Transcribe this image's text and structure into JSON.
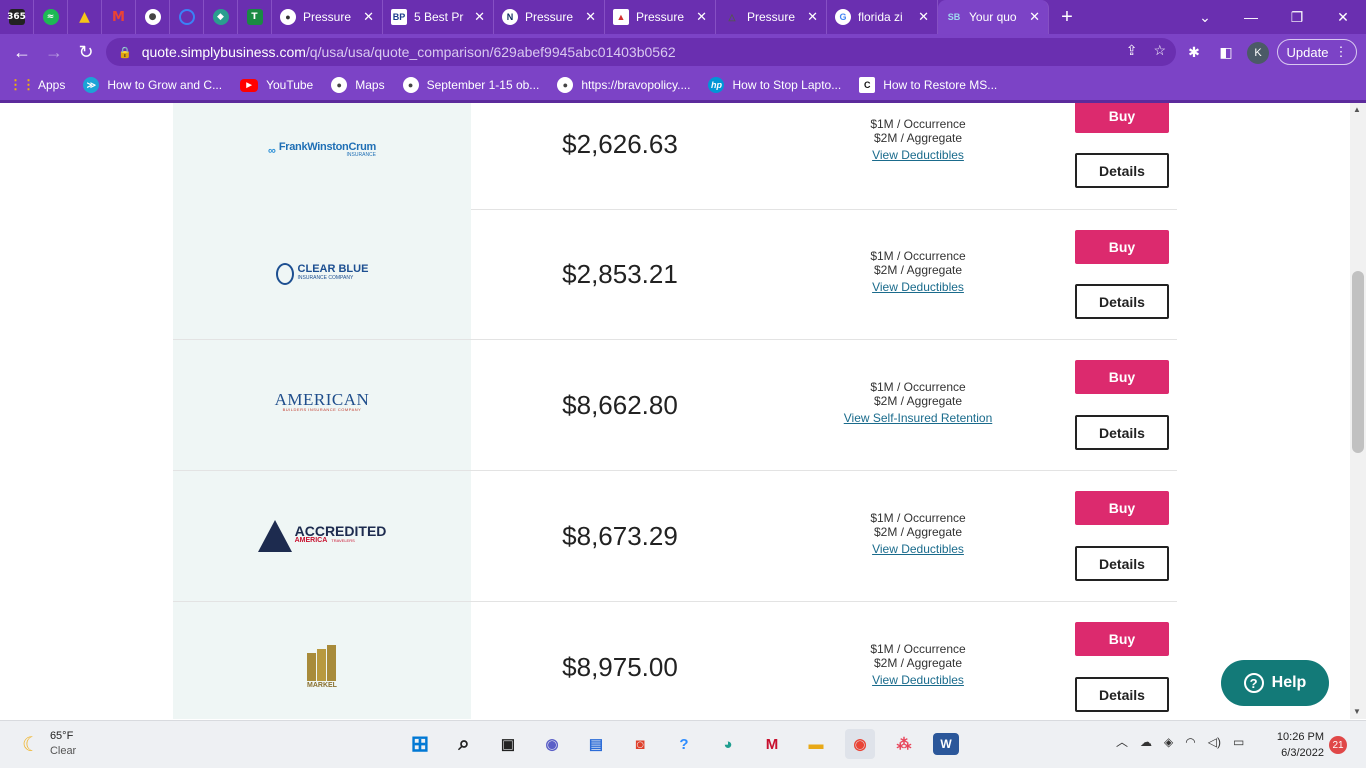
{
  "browser": {
    "tabs": [
      {
        "title": "Pressure",
        "icon": "globe-icon"
      },
      {
        "title": "5 Best Pr",
        "icon": "bp-icon"
      },
      {
        "title": "Pressure",
        "icon": "n-icon"
      },
      {
        "title": "Pressure",
        "icon": "red-logo-icon"
      },
      {
        "title": "Pressure",
        "icon": "triangle-icon"
      },
      {
        "title": "florida zi",
        "icon": "google-icon"
      },
      {
        "title": "Your quo",
        "icon": "sb-icon",
        "active": true
      }
    ],
    "new_tab": "+",
    "url_host": "quote.simplybusiness.com",
    "url_path": "/q/usa/usa/quote_comparison/629abef9945abc01403b0562",
    "avatar": "K",
    "update_label": "Update",
    "bookmarks": [
      {
        "label": "Apps",
        "icon": "apps-grid-icon"
      },
      {
        "label": "How to Grow and C...",
        "icon": "fish-icon"
      },
      {
        "label": "YouTube",
        "icon": "youtube-icon"
      },
      {
        "label": "Maps",
        "icon": "globe-icon"
      },
      {
        "label": "September 1-15 ob...",
        "icon": "globe-icon"
      },
      {
        "label": "https://bravopolicy....",
        "icon": "globe-icon"
      },
      {
        "label": "How to Stop Lapto...",
        "icon": "hp-icon"
      },
      {
        "label": "How to Restore MS...",
        "icon": "c-icon"
      }
    ]
  },
  "quotes": [
    {
      "insurer": "FrankWinstonCrum",
      "insurer_sub": "INSURANCE",
      "price": "$2,626.63",
      "occurrence": "$1M / Occurrence",
      "aggregate": "$2M / Aggregate",
      "link": "View Deductibles",
      "buy": "Buy",
      "details": "Details"
    },
    {
      "insurer": "CLEAR BLUE",
      "insurer_sub": "INSURANCE COMPANY",
      "price": "$2,853.21",
      "occurrence": "$1M / Occurrence",
      "aggregate": "$2M / Aggregate",
      "link": "View Deductibles",
      "buy": "Buy",
      "details": "Details"
    },
    {
      "insurer": "AMERICAN",
      "insurer_sub": "BUILDERS INSURANCE COMPANY",
      "price": "$8,662.80",
      "occurrence": "$1M / Occurrence",
      "aggregate": "$2M / Aggregate",
      "link": "View Self-Insured Retention",
      "buy": "Buy",
      "details": "Details"
    },
    {
      "insurer": "ACCREDITED",
      "insurer_sub": "AMERICA",
      "insurer_tag": "TRAVELERS",
      "price": "$8,673.29",
      "occurrence": "$1M / Occurrence",
      "aggregate": "$2M / Aggregate",
      "link": "View Deductibles",
      "buy": "Buy",
      "details": "Details"
    },
    {
      "insurer": "MARKEL",
      "price": "$8,975.00",
      "occurrence": "$1M / Occurrence",
      "aggregate": "$2M / Aggregate",
      "link": "View Deductibles",
      "buy": "Buy",
      "details": "Details"
    }
  ],
  "help_label": "Help",
  "taskbar": {
    "weather_temp": "65°F",
    "weather_cond": "Clear",
    "time": "10:26 PM",
    "date": "6/3/2022",
    "notifications": "21"
  },
  "colors": {
    "chrome": "#7c43c6",
    "buy": "#dc2a6e",
    "help": "#137a78",
    "link": "#1a6b8c"
  }
}
